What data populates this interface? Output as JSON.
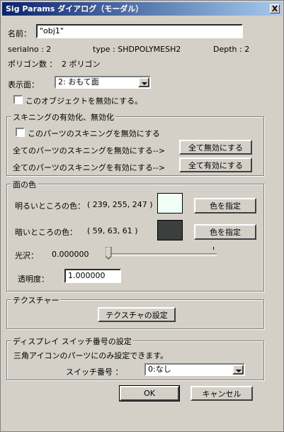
{
  "window": {
    "title": "Sig Params ダイアログ（モーダル）",
    "close_label": "X"
  },
  "name": {
    "label": "名前：",
    "value": "\"obj1\""
  },
  "info": {
    "serial": "serialno : 2",
    "type": "type : SHDPOLYMESH2",
    "depth": "Depth : 2"
  },
  "polygon": {
    "label": "ポリゴン数 ：",
    "value": "2 ポリゴン"
  },
  "display": {
    "label": "表示面：",
    "selected": "2: おもて面"
  },
  "disable_object": {
    "label": "このオブジェクトを無効にする。",
    "checked": false
  },
  "skinning": {
    "legend": "スキニングの有効化、無効化",
    "disable_part_label": "このパーツのスキニングを無効にする",
    "disable_part_checked": false,
    "all_disable_text": "全てのパーツのスキニングを無効にする-->",
    "all_disable_button": "全て無効にする",
    "all_enable_text": "全てのパーツのスキニングを有効にする-->",
    "all_enable_button": "全て有効にする"
  },
  "face_color": {
    "legend": "面の色",
    "bright_label": "明るいところの色：",
    "bright_value": "( 239, 255, 247 )",
    "bright_color": "#effff7",
    "bright_button": "色を指定",
    "dark_label": "暗いところの色：",
    "dark_value": "( 59, 63, 61 )",
    "dark_color": "#3b3f3d",
    "dark_button": "色を指定",
    "gloss_label": "光沢：",
    "gloss_value": "0.000000",
    "gloss_level": 0,
    "opacity_label": "透明度：",
    "opacity_value": "1.000000"
  },
  "texture": {
    "legend": "テクスチャー",
    "button": "テクスチャの設定"
  },
  "switch": {
    "legend": "ディスプレイ スイッチ番号の設定",
    "note": "三角アイコンのパーツにのみ設定できます。",
    "label": "スイッチ番号 ：",
    "selected": "0:なし"
  },
  "footer": {
    "ok": "OK",
    "cancel": "キャンセル"
  }
}
